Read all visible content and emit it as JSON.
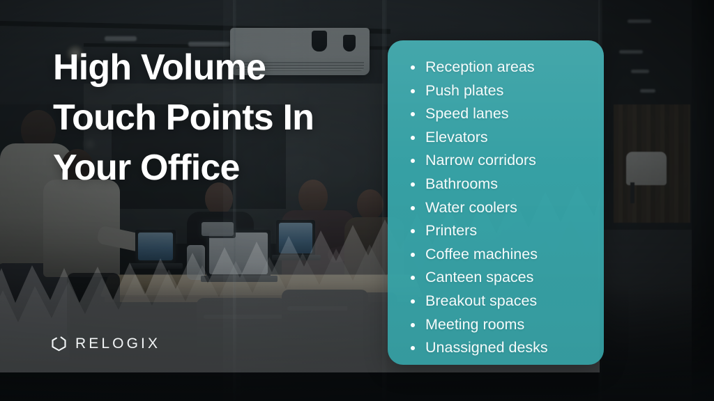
{
  "slide": {
    "title_lines": [
      "High Volume",
      "Touch Points In",
      "Your Office"
    ],
    "title_color": "#ffffff"
  },
  "logo": {
    "wordmark": "RELOGIX",
    "mark_icon": "hexagon-ring-icon",
    "color": "#f2f5f6"
  },
  "panel": {
    "accent_color": "#38a8ac",
    "text_color": "#f4fbfb",
    "bullet_color": "#ffffff",
    "items": [
      "Reception areas",
      "Push plates",
      "Speed lanes",
      "Elevators",
      "Narrow corridors",
      "Bathrooms",
      "Water coolers",
      "Printers",
      "Coffee machines",
      "Canteen spaces",
      "Breakout spaces",
      "Meeting rooms",
      "Unassigned desks"
    ]
  },
  "background": {
    "scene": "dark-office-meeting-room-photo",
    "overlay_graphic": "wavy-zigzag-band"
  }
}
